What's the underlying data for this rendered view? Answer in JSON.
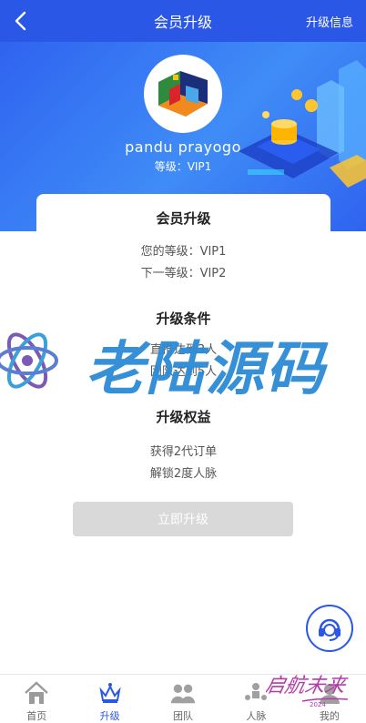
{
  "header": {
    "title": "会员升级",
    "right_link": "升级信息"
  },
  "profile": {
    "username": "pandu prayogo",
    "level_text": "等级：VIP1"
  },
  "card": {
    "title": "会员升级",
    "current_level": "您的等级：VIP1",
    "next_level": "下一等级：VIP2",
    "conditions_title": "升级条件",
    "condition_1": "直推达到3人",
    "condition_2": "团队达到5人",
    "benefits_title": "升级权益",
    "benefit_1": "获得2代订单",
    "benefit_2": "解锁2度人脉",
    "upgrade_button": "立即升级"
  },
  "watermark": {
    "text": "老陆源码"
  },
  "signature": {
    "text": "启航未来"
  },
  "tabbar": {
    "items": [
      {
        "label": "首页",
        "icon": "home-icon"
      },
      {
        "label": "升级",
        "icon": "crown-icon"
      },
      {
        "label": "团队",
        "icon": "team-icon"
      },
      {
        "label": "人脉",
        "icon": "network-icon"
      },
      {
        "label": "我的",
        "icon": "profile-icon"
      }
    ],
    "active_index": 1
  },
  "colors": {
    "primary": "#2a57e6",
    "disabled_button": "#d9d9d9",
    "watermark": "#2b8bd6"
  }
}
